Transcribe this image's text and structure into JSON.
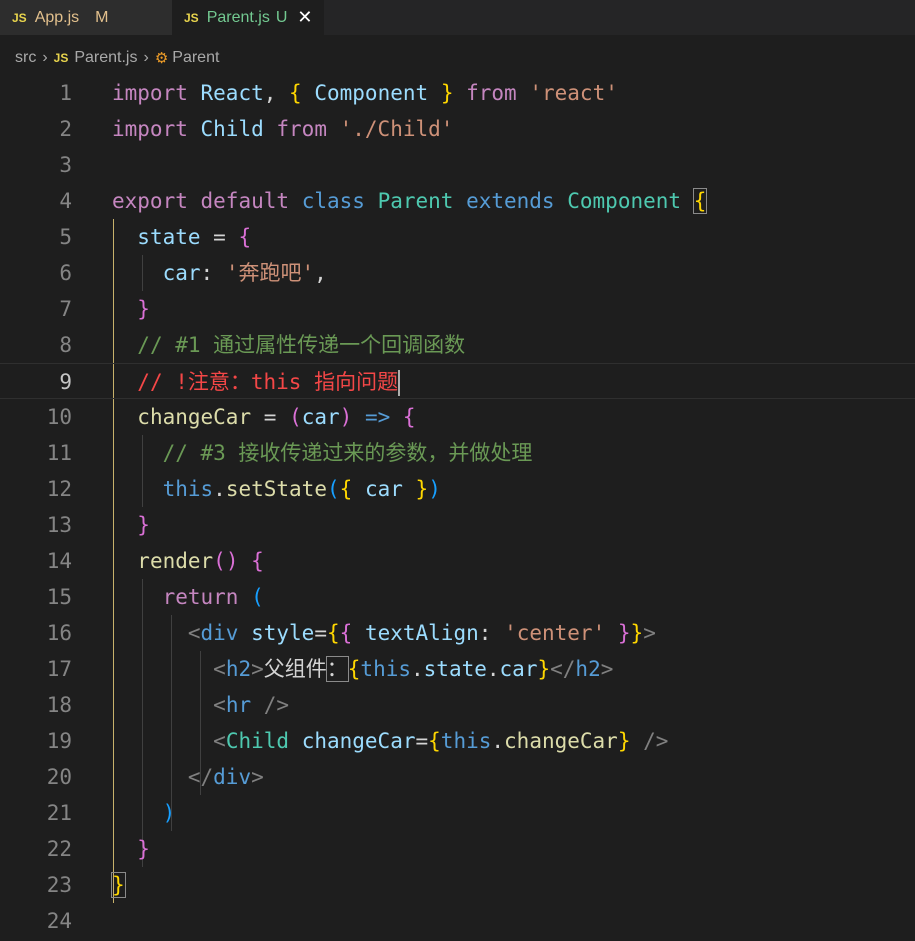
{
  "tabs": [
    {
      "icon": "JS",
      "name": "App.js",
      "status": "M"
    },
    {
      "icon": "JS",
      "name": "Parent.js",
      "status": "U",
      "close": "✕"
    }
  ],
  "breadcrumb": {
    "folder": "src",
    "file_icon": "JS",
    "file": "Parent.js",
    "symbol": "Parent"
  },
  "lines": [
    {
      "n": "1"
    },
    {
      "n": "2"
    },
    {
      "n": "3"
    },
    {
      "n": "4"
    },
    {
      "n": "5"
    },
    {
      "n": "6"
    },
    {
      "n": "7"
    },
    {
      "n": "8"
    },
    {
      "n": "9"
    },
    {
      "n": "10"
    },
    {
      "n": "11"
    },
    {
      "n": "12"
    },
    {
      "n": "13"
    },
    {
      "n": "14"
    },
    {
      "n": "15"
    },
    {
      "n": "16"
    },
    {
      "n": "17"
    },
    {
      "n": "18"
    },
    {
      "n": "19"
    },
    {
      "n": "20"
    },
    {
      "n": "21"
    },
    {
      "n": "22"
    },
    {
      "n": "23"
    },
    {
      "n": "24"
    }
  ],
  "tok": {
    "import": "import",
    "react": "React",
    "comma": ",",
    "lbrace": "{",
    "rbrace": "}",
    "component": "Component",
    "from": "from",
    "react_str": "'react'",
    "child": "Child",
    "child_path": "'./Child'",
    "export": "export",
    "default": "default",
    "class": "class",
    "parent": "Parent",
    "extends": "extends",
    "state": "state",
    "eq": "=",
    "car": "car",
    "colon": ":",
    "car_val": "'奔跑吧'",
    "comment1": "// #1 通过属性传递一个回调函数",
    "comment2": "// !注意：this 指向问题",
    "changeCar": "changeCar",
    "lparen": "(",
    "rparen": ")",
    "arrow": "=>",
    "comment3": "// #3 接收传递过来的参数，并做处理",
    "this": "this",
    "dot": ".",
    "setState": "setState",
    "render": "render",
    "return": "return",
    "lt": "<",
    "gt": ">",
    "div": "div",
    "style": "style",
    "textAlign": "textAlign",
    "center": "'center'",
    "h2": "h2",
    "h2_text": "父组件",
    "fw_colon": "：",
    "close_lt": "</",
    "hr": "hr",
    "self_close": "/>"
  }
}
